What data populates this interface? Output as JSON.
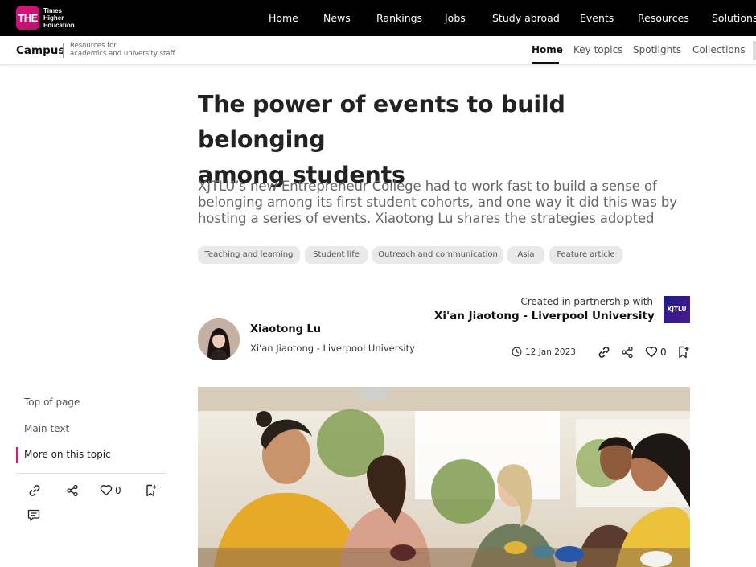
{
  "brand": {
    "logo_mark": "THE",
    "logo_text": [
      "Times",
      "Higher",
      "Education"
    ]
  },
  "top_nav": [
    "Home",
    "News",
    "Rankings",
    "Jobs",
    "Study abroad",
    "Events",
    "Resources",
    "Solutions"
  ],
  "sub_bar": {
    "title": "Campus",
    "subtitle": [
      "Resources for",
      "academics and university staff"
    ],
    "nav": [
      "Home",
      "Key topics",
      "Spotlights",
      "Collections"
    ],
    "active": "Home"
  },
  "article": {
    "headline": [
      "The power of events to build belonging",
      "among students"
    ],
    "standfirst": "XJTLU’s new Entrepreneur College had to work fast to build a sense of belonging among its first student cohorts, and one way it did this was by hosting a series of events. Xiaotong Lu shares the strategies adopted",
    "tags": [
      "Teaching and learning",
      "Student life",
      "Outreach and communication",
      "Asia",
      "Feature article"
    ],
    "partner_line": "Created in partnership with",
    "partner_name": "Xi'an Jiaotong - Liverpool University",
    "partner_logo_text": "XJTLU",
    "author_name": "Xiaotong Lu",
    "author_org": "Xi'an Jiaotong - Liverpool University",
    "date": "12 Jan 2023",
    "likes": "0"
  },
  "sidebar": {
    "links": [
      "Top of page",
      "Main text",
      "More on this topic"
    ],
    "active_index": 2,
    "likes": "0"
  },
  "icons": [
    "link-icon",
    "share-icon",
    "heart-icon",
    "bookmark-icon",
    "comment-icon",
    "clock-icon"
  ],
  "colors": {
    "accent": "#d6196f",
    "topbar": "#000000",
    "tag_bg": "#e9e9e9"
  }
}
